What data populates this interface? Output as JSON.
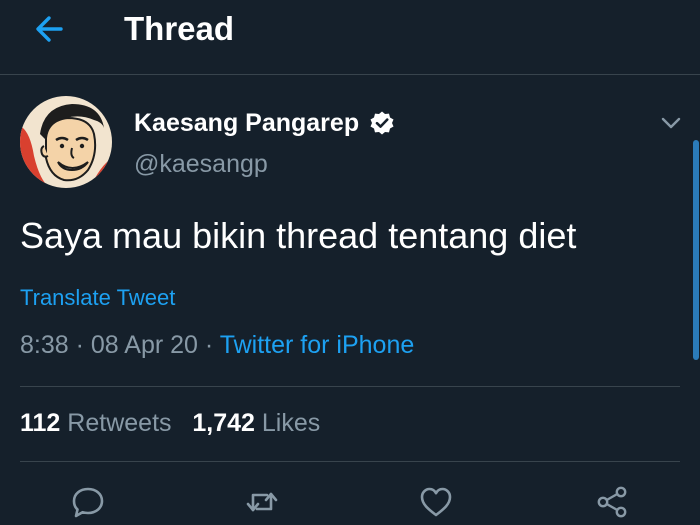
{
  "header": {
    "title": "Thread"
  },
  "tweet": {
    "display_name": "Kaesang Pangarep",
    "handle": "@kaesangp",
    "text": "Saya mau bikin thread tentang diet",
    "translate_label": "Translate Tweet",
    "time": "8:38",
    "separator": "·",
    "date": "08 Apr 20",
    "source": "Twitter for iPhone"
  },
  "stats": {
    "retweets_count": "112",
    "retweets_label": "Retweets",
    "likes_count": "1,742",
    "likes_label": "Likes"
  },
  "icons": {
    "back": "arrow-left-icon",
    "verified": "verified-badge-icon",
    "caret": "chevron-down-icon",
    "reply": "reply-icon",
    "retweet": "retweet-icon",
    "like": "heart-icon",
    "share": "share-icon"
  },
  "colors": {
    "background": "#15202b",
    "accent": "#1da1f2",
    "secondary_text": "#8899a6",
    "divider": "#38444d"
  }
}
